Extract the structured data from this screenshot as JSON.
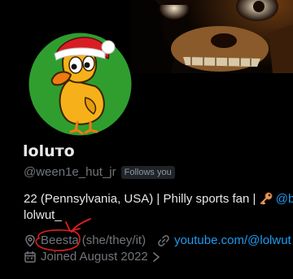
{
  "profile": {
    "display_name": "loluтo",
    "handle": "@ween1e_hut_jr",
    "follows_badge": "Follows you"
  },
  "bio": {
    "line1_text": "22 (Pennsylvania, USA) | Philly sports fan | ",
    "line1_mention": "@be",
    "line2": "lolwut_"
  },
  "meta": {
    "location": "Beesta",
    "pronouns": "(she/they/it)",
    "link": "youtube.com/@lolwut",
    "joined": "Joined August 2022"
  },
  "colors": {
    "background": "#000000",
    "text": "#e7e9ea",
    "muted": "#71767b",
    "accent": "#1d9bf0",
    "annotation": "#e0201f",
    "avatar_bg": "#2f9e2f"
  },
  "icons": {
    "key": "key-icon",
    "location": "location-pin-icon",
    "link": "link-icon",
    "calendar": "calendar-icon",
    "chevron": "chevron-right-icon"
  }
}
